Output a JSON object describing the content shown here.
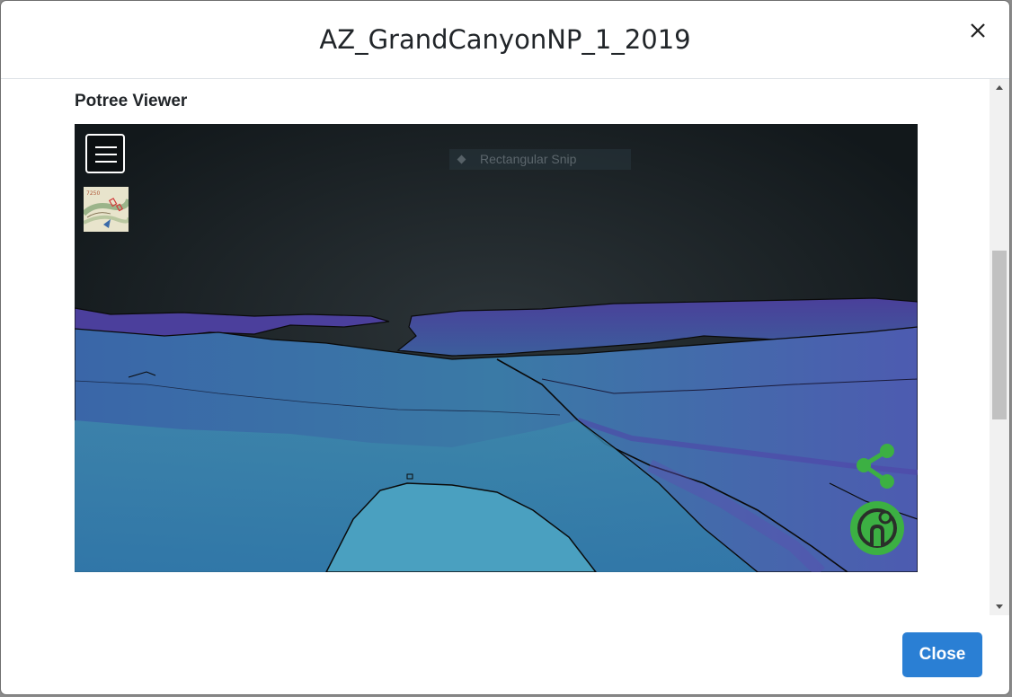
{
  "dialog": {
    "title": "AZ_GrandCanyonNP_1_2019",
    "close_label": "Close"
  },
  "viewer": {
    "section_title": "Potree Viewer",
    "overlay_tooltip": "Rectangular Snip",
    "menu_icon": "hamburger-menu-icon",
    "map_thumbnail": "topographic-map-thumbnail",
    "map_thumbnail_label": "7250",
    "share_icon": "share-icon",
    "logo_icon": "opentopography-logo-icon"
  },
  "colors": {
    "primary_button": "#2a7fd4",
    "accent_green": "#3cb043",
    "sky": "#1a2024",
    "terrain_blue": "#3a7fa8",
    "terrain_purple": "#5a4fa8"
  }
}
